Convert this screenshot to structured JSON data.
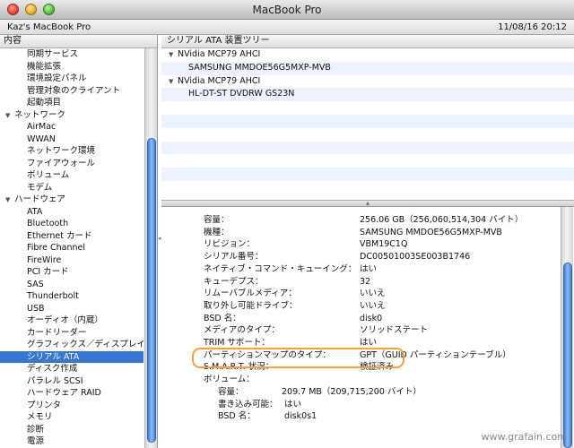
{
  "window": {
    "title": "MacBook Pro"
  },
  "header": {
    "machine_name": "Kaz's MacBook Pro",
    "timestamp": "11/08/16 20:12"
  },
  "sidebar": {
    "header": "内容",
    "items": [
      {
        "label": "同期サービス",
        "kind": "item"
      },
      {
        "label": "機能拡張",
        "kind": "item"
      },
      {
        "label": "環境設定パネル",
        "kind": "item"
      },
      {
        "label": "管理対象のクライアント",
        "kind": "item"
      },
      {
        "label": "起動項目",
        "kind": "item"
      },
      {
        "label": "ネットワーク",
        "kind": "category"
      },
      {
        "label": "AirMac",
        "kind": "item"
      },
      {
        "label": "WWAN",
        "kind": "item"
      },
      {
        "label": "ネットワーク環境",
        "kind": "item"
      },
      {
        "label": "ファイアウォール",
        "kind": "item"
      },
      {
        "label": "ボリューム",
        "kind": "item"
      },
      {
        "label": "モデム",
        "kind": "item"
      },
      {
        "label": "ハードウェア",
        "kind": "category"
      },
      {
        "label": "ATA",
        "kind": "item"
      },
      {
        "label": "Bluetooth",
        "kind": "item"
      },
      {
        "label": "Ethernet カード",
        "kind": "item"
      },
      {
        "label": "Fibre Channel",
        "kind": "item"
      },
      {
        "label": "FireWire",
        "kind": "item"
      },
      {
        "label": "PCI カード",
        "kind": "item"
      },
      {
        "label": "SAS",
        "kind": "item"
      },
      {
        "label": "Thunderbolt",
        "kind": "item"
      },
      {
        "label": "USB",
        "kind": "item"
      },
      {
        "label": "オーディオ（内蔵）",
        "kind": "item"
      },
      {
        "label": "カードリーダー",
        "kind": "item"
      },
      {
        "label": "グラフィックス／ディスプレイ",
        "kind": "item"
      },
      {
        "label": "シリアル ATA",
        "kind": "item",
        "selected": true
      },
      {
        "label": "ディスク作成",
        "kind": "item"
      },
      {
        "label": "パラレル SCSI",
        "kind": "item"
      },
      {
        "label": "ハードウェア RAID",
        "kind": "item"
      },
      {
        "label": "プリンタ",
        "kind": "item"
      },
      {
        "label": "メモリ",
        "kind": "item"
      },
      {
        "label": "診断",
        "kind": "item"
      },
      {
        "label": "電源",
        "kind": "item"
      }
    ]
  },
  "tree": {
    "header": "シリアル ATA 装置ツリー",
    "rows": [
      {
        "label": "NVidia MCP79 AHCI",
        "kind": "ctrl"
      },
      {
        "label": "SAMSUNG MMDOE56G5MXP-MVB",
        "kind": "dev"
      },
      {
        "label": "NVidia MCP79 AHCI",
        "kind": "ctrl"
      },
      {
        "label": "HL-DT-ST DVDRW  GS23N",
        "kind": "dev"
      },
      {
        "label": "",
        "kind": "empty"
      },
      {
        "label": "",
        "kind": "empty"
      },
      {
        "label": "",
        "kind": "empty"
      },
      {
        "label": "",
        "kind": "empty"
      },
      {
        "label": "",
        "kind": "empty"
      },
      {
        "label": "",
        "kind": "empty"
      },
      {
        "label": "",
        "kind": "empty"
      }
    ]
  },
  "details": [
    {
      "label": "容量：",
      "value": "256.06 GB（256,060,514,304 バイト）",
      "level": 0
    },
    {
      "label": "機種：",
      "value": "SAMSUNG MMDOE56G5MXP-MVB",
      "level": 0
    },
    {
      "label": "リビジョン：",
      "value": "VBM19C1Q",
      "level": 0
    },
    {
      "label": "シリアル番号：",
      "value": "DC00501003SE003B1746",
      "level": 0
    },
    {
      "label": "ネイティブ・コマンド・キューイング：",
      "value": "はい",
      "level": 0
    },
    {
      "label": "キューデプス：",
      "value": "32",
      "level": 0
    },
    {
      "label": "リムーバブルメディア：",
      "value": "いいえ",
      "level": 0
    },
    {
      "label": "取り外し可能ドライブ：",
      "value": "いいえ",
      "level": 0
    },
    {
      "label": "BSD 名：",
      "value": "disk0",
      "level": 0
    },
    {
      "label": "メディアのタイプ：",
      "value": "ソリッドステート",
      "level": 0
    },
    {
      "label": "TRIM サポート：",
      "value": "はい",
      "level": 0
    },
    {
      "label": "パーティションマップのタイプ：",
      "value": "GPT（GUID パーティションテーブル）",
      "level": 0
    },
    {
      "label": "S.M.A.R.T. 状況：",
      "value": "検証済み",
      "level": 0
    },
    {
      "label": "ボリューム：",
      "value": "",
      "level": 0
    },
    {
      "label": "容量：",
      "value": "209.7 MB（209,715,200 バイト）",
      "level": 1
    },
    {
      "label": "書き込み可能：",
      "value": "はい",
      "level": 2
    },
    {
      "label": "BSD 名：",
      "value": "disk0s1",
      "level": 2
    }
  ],
  "watermark": "www.grafain.com",
  "colors": {
    "selection": "#3875d7",
    "highlight_ring": "#f2a23a",
    "scroll_thumb": "#3d7fd9"
  }
}
